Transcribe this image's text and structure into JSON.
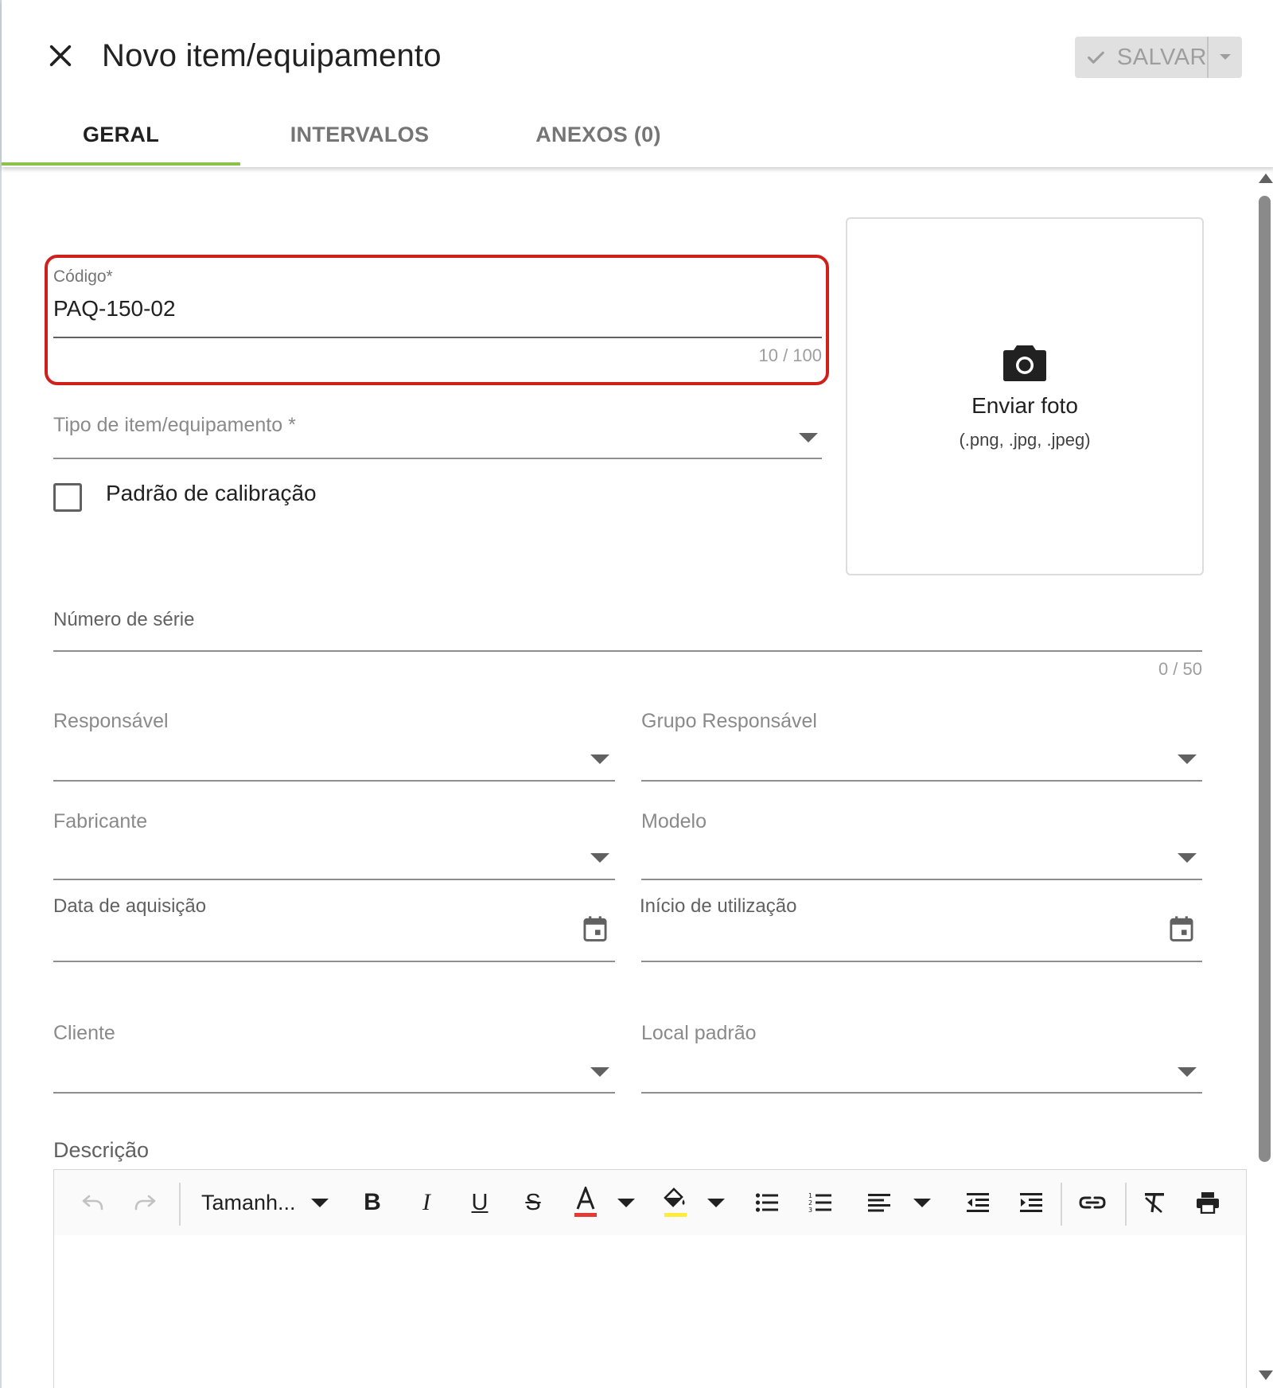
{
  "header": {
    "title": "Novo item/equipamento",
    "save_label": "SALVAR"
  },
  "tabs": [
    {
      "label": "GERAL",
      "active": true
    },
    {
      "label": "INTERVALOS",
      "active": false
    },
    {
      "label": "ANEXOS (0)",
      "active": false
    }
  ],
  "form": {
    "codigo": {
      "label": "Código*",
      "value": "PAQ-150-02",
      "counter": "10 / 100"
    },
    "tipo": {
      "label": "Tipo de item/equipamento *"
    },
    "padrao_calibracao": {
      "label": "Padrão de calibração",
      "checked": false
    },
    "photo": {
      "label": "Enviar foto",
      "formats": "(.png, .jpg, .jpeg)"
    },
    "numero_serie": {
      "label": "Número de série",
      "counter": "0 / 50"
    },
    "responsavel": {
      "label": "Responsável"
    },
    "grupo_responsavel": {
      "label": "Grupo Responsável"
    },
    "fabricante": {
      "label": "Fabricante"
    },
    "modelo": {
      "label": "Modelo"
    },
    "data_aquisicao": {
      "label": "Data de aquisição"
    },
    "inicio_utilizacao": {
      "label": "Início de utilização"
    },
    "cliente": {
      "label": "Cliente"
    },
    "local_padrao": {
      "label": "Local padrão"
    },
    "descricao": {
      "label": "Descrição"
    }
  },
  "editor_toolbar": {
    "font_size_label": "Tamanh...",
    "font_color": "#e53935",
    "highlight_color": "#ffeb3b"
  },
  "colors": {
    "accent": "#8bc34a",
    "highlight_border": "#d0201b"
  }
}
